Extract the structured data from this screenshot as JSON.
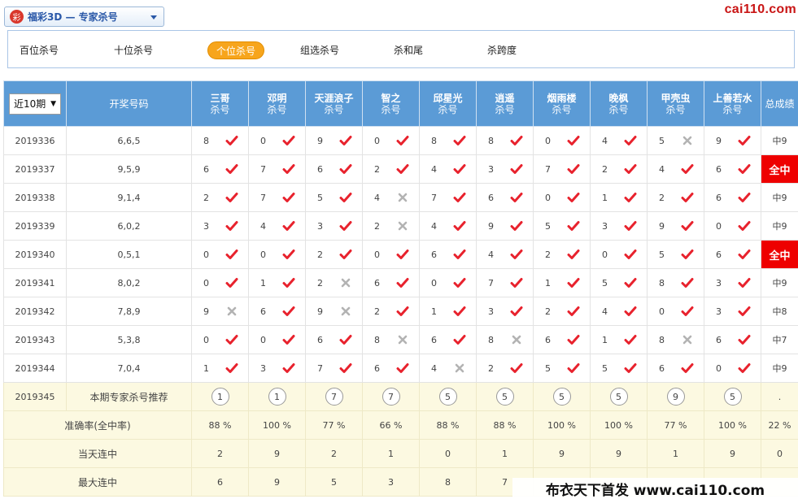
{
  "header": {
    "lottery_logo_text": "彩",
    "lottery_title": "福彩3D — 专家杀号",
    "site_logo": "cai110.com"
  },
  "tabs": [
    "百位杀号",
    "十位杀号",
    "个位杀号",
    "组选杀号",
    "杀和尾",
    "杀跨度"
  ],
  "active_tab": 2,
  "table": {
    "period_select": "近10期",
    "draw_col_header": "开奖号码",
    "total_header": "总成绩",
    "sub_label": "杀号",
    "experts": [
      "三哥",
      "邓明",
      "天涯浪子",
      "智之",
      "邱星光",
      "逍遥",
      "烟雨楼",
      "晚枫",
      "甲壳虫",
      "上善若水"
    ],
    "rows": [
      {
        "period": "2019336",
        "draw": "6,6,5",
        "kills": [
          [
            "8",
            "y"
          ],
          [
            "0",
            "y"
          ],
          [
            "9",
            "y"
          ],
          [
            "0",
            "y"
          ],
          [
            "8",
            "y"
          ],
          [
            "8",
            "y"
          ],
          [
            "0",
            "y"
          ],
          [
            "4",
            "y"
          ],
          [
            "5",
            "n"
          ],
          [
            "9",
            "y"
          ]
        ],
        "total": "中9",
        "all": false
      },
      {
        "period": "2019337",
        "draw": "9,5,9",
        "kills": [
          [
            "6",
            "y"
          ],
          [
            "7",
            "y"
          ],
          [
            "6",
            "y"
          ],
          [
            "2",
            "y"
          ],
          [
            "4",
            "y"
          ],
          [
            "3",
            "y"
          ],
          [
            "7",
            "y"
          ],
          [
            "2",
            "y"
          ],
          [
            "4",
            "y"
          ],
          [
            "6",
            "y"
          ]
        ],
        "total": "全中",
        "all": true
      },
      {
        "period": "2019338",
        "draw": "9,1,4",
        "kills": [
          [
            "2",
            "y"
          ],
          [
            "7",
            "y"
          ],
          [
            "5",
            "y"
          ],
          [
            "4",
            "n"
          ],
          [
            "7",
            "y"
          ],
          [
            "6",
            "y"
          ],
          [
            "0",
            "y"
          ],
          [
            "1",
            "y"
          ],
          [
            "2",
            "y"
          ],
          [
            "6",
            "y"
          ]
        ],
        "total": "中9",
        "all": false
      },
      {
        "period": "2019339",
        "draw": "6,0,2",
        "kills": [
          [
            "3",
            "y"
          ],
          [
            "4",
            "y"
          ],
          [
            "3",
            "y"
          ],
          [
            "2",
            "n"
          ],
          [
            "4",
            "y"
          ],
          [
            "9",
            "y"
          ],
          [
            "5",
            "y"
          ],
          [
            "3",
            "y"
          ],
          [
            "9",
            "y"
          ],
          [
            "0",
            "y"
          ]
        ],
        "total": "中9",
        "all": false
      },
      {
        "period": "2019340",
        "draw": "0,5,1",
        "kills": [
          [
            "0",
            "y"
          ],
          [
            "0",
            "y"
          ],
          [
            "2",
            "y"
          ],
          [
            "0",
            "y"
          ],
          [
            "6",
            "y"
          ],
          [
            "4",
            "y"
          ],
          [
            "2",
            "y"
          ],
          [
            "0",
            "y"
          ],
          [
            "5",
            "y"
          ],
          [
            "6",
            "y"
          ]
        ],
        "total": "全中",
        "all": true
      },
      {
        "period": "2019341",
        "draw": "8,0,2",
        "kills": [
          [
            "0",
            "y"
          ],
          [
            "1",
            "y"
          ],
          [
            "2",
            "n"
          ],
          [
            "6",
            "y"
          ],
          [
            "0",
            "y"
          ],
          [
            "7",
            "y"
          ],
          [
            "1",
            "y"
          ],
          [
            "5",
            "y"
          ],
          [
            "8",
            "y"
          ],
          [
            "3",
            "y"
          ]
        ],
        "total": "中9",
        "all": false
      },
      {
        "period": "2019342",
        "draw": "7,8,9",
        "kills": [
          [
            "9",
            "n"
          ],
          [
            "6",
            "y"
          ],
          [
            "9",
            "n"
          ],
          [
            "2",
            "y"
          ],
          [
            "1",
            "y"
          ],
          [
            "3",
            "y"
          ],
          [
            "2",
            "y"
          ],
          [
            "4",
            "y"
          ],
          [
            "0",
            "y"
          ],
          [
            "3",
            "y"
          ]
        ],
        "total": "中8",
        "all": false
      },
      {
        "period": "2019343",
        "draw": "5,3,8",
        "kills": [
          [
            "0",
            "y"
          ],
          [
            "0",
            "y"
          ],
          [
            "6",
            "y"
          ],
          [
            "8",
            "n"
          ],
          [
            "6",
            "y"
          ],
          [
            "8",
            "n"
          ],
          [
            "6",
            "y"
          ],
          [
            "1",
            "y"
          ],
          [
            "8",
            "n"
          ],
          [
            "6",
            "y"
          ]
        ],
        "total": "中7",
        "all": false
      },
      {
        "period": "2019344",
        "draw": "7,0,4",
        "kills": [
          [
            "1",
            "y"
          ],
          [
            "3",
            "y"
          ],
          [
            "7",
            "y"
          ],
          [
            "6",
            "y"
          ],
          [
            "4",
            "n"
          ],
          [
            "2",
            "y"
          ],
          [
            "5",
            "y"
          ],
          [
            "5",
            "y"
          ],
          [
            "6",
            "y"
          ],
          [
            "0",
            "y"
          ]
        ],
        "total": "中9",
        "all": false
      }
    ],
    "recommend": {
      "period": "2019345",
      "label": "本期专家杀号推荐",
      "values": [
        "1",
        "1",
        "7",
        "7",
        "5",
        "5",
        "5",
        "5",
        "9",
        "5"
      ],
      "total": "."
    },
    "stats": [
      {
        "label": "准确率(全中率)",
        "values": [
          "88 %",
          "100 %",
          "77 %",
          "66 %",
          "88 %",
          "88 %",
          "100 %",
          "100 %",
          "77 %",
          "100 %"
        ],
        "total": "22 %"
      },
      {
        "label": "当天连中",
        "values": [
          "2",
          "9",
          "2",
          "1",
          "0",
          "1",
          "9",
          "9",
          "1",
          "9"
        ],
        "total": "0"
      },
      {
        "label": "最大连中",
        "values": [
          "6",
          "9",
          "5",
          "3",
          "8",
          "7",
          "",
          "",
          "",
          ""
        ],
        "total": ""
      }
    ]
  },
  "watermark": "布衣天下首发 www.cai110.com",
  "colors": {
    "header_blue": "#5b9bd6",
    "hit_red": "#e8222d",
    "miss_gray": "#b3b3b3",
    "all_hit_bg": "#ee0000",
    "active_tab": "#f7a51c",
    "stats_bg": "#fcf9e1"
  }
}
